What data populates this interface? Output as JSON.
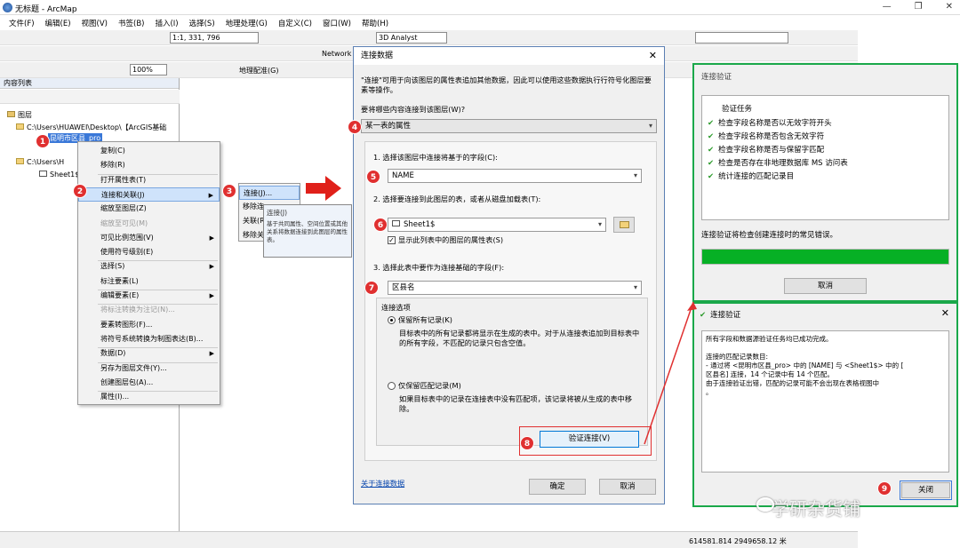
{
  "app": {
    "title": "无标题 - ArcMap"
  },
  "menu": [
    "文件(F)",
    "编辑(E)",
    "视图(V)",
    "书签(B)",
    "插入(I)",
    "选择(S)",
    "地理处理(G)",
    "自定义(C)",
    "窗口(W)",
    "帮助(H)"
  ],
  "toolbar": {
    "scale": "1:1, 331, 796",
    "analyst": "3D Analyst",
    "network": "Network",
    "zoom": "100%",
    "georef": "地理配准(G)"
  },
  "toc": {
    "title": "内容列表",
    "layers_label": "图层",
    "path1": "C:\\Users\\HUAWEI\\Desktop\\【ArcGIS基础",
    "layer_name": "昆明市区县_pro",
    "path2": "C:\\Users\\H",
    "table_name": "Sheet1$"
  },
  "context_menu": {
    "items": [
      "复制(C)",
      "移除(R)",
      "打开属性表(T)",
      "连接和关联(J)",
      "缩放至图层(Z)",
      "缩放至可见(M)",
      "可见比例范围(V)",
      "使用符号级别(E)",
      "选择(S)",
      "标注要素(L)",
      "编辑要素(E)",
      "将标注转换为注记(N)...",
      "要素转图形(F)...",
      "将符号系统转换为制图表达(B)...",
      "数据(D)",
      "另存为图层文件(Y)...",
      "创建图层包(A)...",
      "属性(I)..."
    ],
    "submenu": [
      "连接(J)...",
      "移除连",
      "关联(R",
      "移除关"
    ],
    "tooltip_title": "连接(J)",
    "tooltip_body": "基于共同属性、空间位置或其他关系将数据连接到此图层的属性表。"
  },
  "badges": [
    "1",
    "2",
    "3",
    "4",
    "5",
    "6",
    "7",
    "8",
    "9"
  ],
  "dialog": {
    "title": "连接数据",
    "intro": "\"连接\"可用于向该图层的属性表追加其他数据，因此可以使用这些数据执行行符号化图层要素等操作。",
    "q": "要将哪些内容连接到该图层(W)?",
    "mode": "某一表的属性",
    "step1": "1. 选择该图层中连接将基于的字段(C):",
    "field1": "NAME",
    "step2": "2. 选择要连接到此图层的表，或者从磁盘加载表(T):",
    "table": "Sheet1$",
    "showattr": "显示此列表中的图层的属性表(S)",
    "step3": "3. 选择此表中要作为连接基础的字段(F):",
    "field3": "区县名",
    "opts": "连接选项",
    "keepall": "保留所有记录(K)",
    "keepall_desc": "目标表中的所有记录都将显示在生成的表中。对于从连接表追加到目标表中的所有字段，不匹配的记录只包含空值。",
    "keepmatch": "仅保留匹配记录(M)",
    "keepmatch_desc": "如果目标表中的记录在连接表中没有匹配项，该记录将被从生成的表中移除。",
    "validate": "验证连接(V)",
    "about": "关于连接数据",
    "ok": "确定",
    "cancel": "取消"
  },
  "validation1": {
    "title": "连接验证",
    "header": "验证任务",
    "tasks": [
      "检查字段名称是否以无效字符开头",
      "检查字段名称是否包含无效字符",
      "检查字段名称是否与保留字匹配",
      "检查是否存在非地理数据库 MS 访问表",
      "统计连接的匹配记录目"
    ],
    "status": "连接验证将检查创建连接时的常见错误。",
    "cancel": "取消"
  },
  "validation2": {
    "title": "连接验证",
    "lines": [
      "所有字段和数据源验证任务均已成功完成。",
      "",
      "连接的匹配记录数目:",
      "- 通过将 <昆明市区县_pro> 中的 [NAME] 与 <Sheet1$> 中的 [",
      "区县名] 连接，14 个记录中有 14 个匹配。",
      "由于连接验证出错，匹配的记录可能不会出现在表格视图中",
      "。"
    ],
    "close": "关闭"
  },
  "statusbar": {
    "coords": "614581.814  2949658.12 米"
  },
  "watermark": "学研杂货铺",
  "colors": {
    "accent": "#e03030",
    "green": "#1aa84a",
    "highlight": "#3a78d8"
  }
}
